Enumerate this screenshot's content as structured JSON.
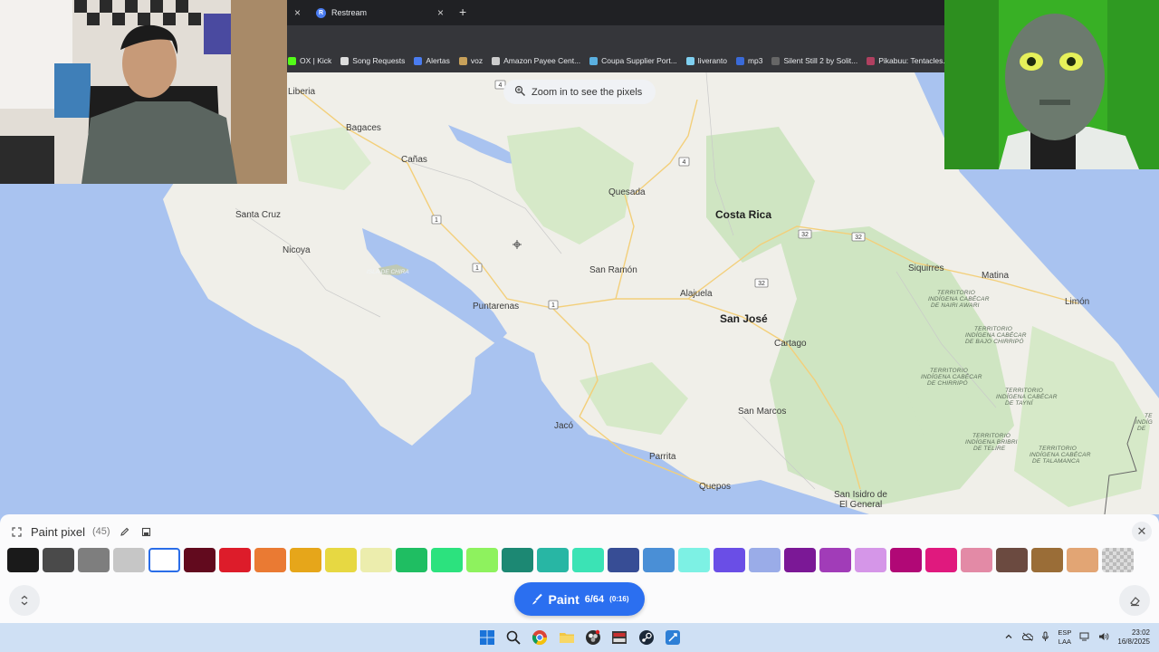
{
  "browser": {
    "tab_title": "Restream",
    "tab_favicon_letter": "R",
    "close_symbol": "×",
    "new_tab_symbol": "+",
    "bookmarks": [
      {
        "label": "OX | Kick",
        "icon": "kick-icon",
        "color": "#53fc18"
      },
      {
        "label": "Song Requests",
        "icon": "skull-icon",
        "color": "#dddddd"
      },
      {
        "label": "Alertas",
        "icon": "alert-icon",
        "color": "#4a7cf0"
      },
      {
        "label": "voz",
        "icon": "folder-icon",
        "color": "#c8a15a"
      },
      {
        "label": "Amazon Payee Cent...",
        "icon": "globe-icon",
        "color": "#cccccc"
      },
      {
        "label": "Coupa Supplier Port...",
        "icon": "coupa-icon",
        "color": "#5ab0e0"
      },
      {
        "label": "liveranto",
        "icon": "bird-icon",
        "color": "#7fd0f0"
      },
      {
        "label": "mp3",
        "icon": "chevron-icon",
        "color": "#3a6ad8"
      },
      {
        "label": "Silent Still 2 by Solit...",
        "icon": "game-icon",
        "color": "#666666"
      },
      {
        "label": "Pikabuu: Tentacles...",
        "icon": "image-icon",
        "color": "#b04060"
      }
    ]
  },
  "map": {
    "zoom_hint": "Zoom in to see the pixels",
    "labels": {
      "liberia": "Liberia",
      "bagaces": "Bagaces",
      "canas": "Cañas",
      "santa_cruz": "Santa Cruz",
      "nicoya": "Nicoya",
      "isla_chira": "ISLA DE CHIRA",
      "quesada": "Quesada",
      "costa_rica": "Costa Rica",
      "san_ramon": "San Ramón",
      "alajuela": "Alajuela",
      "puntarenas": "Puntarenas",
      "san_jose": "San José",
      "cartago": "Cartago",
      "siquirres": "Siquirres",
      "matina": "Matina",
      "limon": "Limón",
      "san_marcos": "San Marcos",
      "jaco": "Jacó",
      "parrita": "Parrita",
      "quepos": "Quepos",
      "san_isidro_1": "San Isidro de",
      "san_isidro_2": "El General"
    },
    "territories": {
      "nairi_1": "TERRITORIO",
      "nairi_2": "INDÍGENA CABÉCAR",
      "nairi_3": "DE NAIRI AWARI",
      "bajo_1": "TERRITORIO",
      "bajo_2": "INDÍGENA CABÉCAR",
      "bajo_3": "DE BAJO CHIRRIPÓ",
      "chirripo_1": "TERRITORIO",
      "chirripo_2": "INDÍGENA CABÉCAR",
      "chirripo_3": "DE CHIRRIPÓ",
      "tayni_1": "TERRITORIO",
      "tayni_2": "INDÍGENA CABÉCAR",
      "tayni_3": "DE TAYNÍ",
      "telire_1": "TERRITORIO",
      "telire_2": "INDÍGENA BRIBRI",
      "telire_3": "DE TELIRE",
      "talamanca_1": "TERRITORIO",
      "talamanca_2": "INDÍGENA CABÉCAR",
      "talamanca_3": "DE TALAMANCA",
      "edge_1": "TE",
      "edge_2": "INDÍG",
      "edge_3": "DE"
    },
    "routes": {
      "r1a": "1",
      "r1b": "1",
      "r1c": "1",
      "r4a": "4",
      "r4b": "4",
      "r32a": "32",
      "r32b": "32",
      "r32c": "32"
    },
    "colors": {
      "water": "#a9c3f0",
      "land": "#f0efe9",
      "forest": "#cfe5c2"
    }
  },
  "paint_panel": {
    "title": "Paint pixel",
    "count": "(45)",
    "close_symbol": "✕",
    "paint_button_label": "Paint",
    "paint_progress": "6/64",
    "paint_timer": "(0:16)",
    "colors": [
      "#1a1a1a",
      "#4a4a4a",
      "#7e7e7e",
      "#c6c6c6",
      "#ffffff",
      "#620a1e",
      "#dd1c2a",
      "#ea7a33",
      "#e6a61a",
      "#e7d842",
      "#ecedad",
      "#1fbe62",
      "#2ce27e",
      "#8ef25e",
      "#1c8873",
      "#28b6a4",
      "#3be3b5",
      "#374d95",
      "#4a8fd6",
      "#7df1e4",
      "#6a4ee6",
      "#9aace8",
      "#7b1896",
      "#a13cb8",
      "#d596e8",
      "#b10876",
      "#e0197e",
      "#e38aa6",
      "#6b4a40",
      "#9a6d37",
      "#e2a574",
      "transparent"
    ],
    "selected_index": 4
  },
  "taskbar": {
    "lang_1": "ESP",
    "lang_2": "LAA",
    "time": "23:02",
    "date": "16/8/2025"
  }
}
